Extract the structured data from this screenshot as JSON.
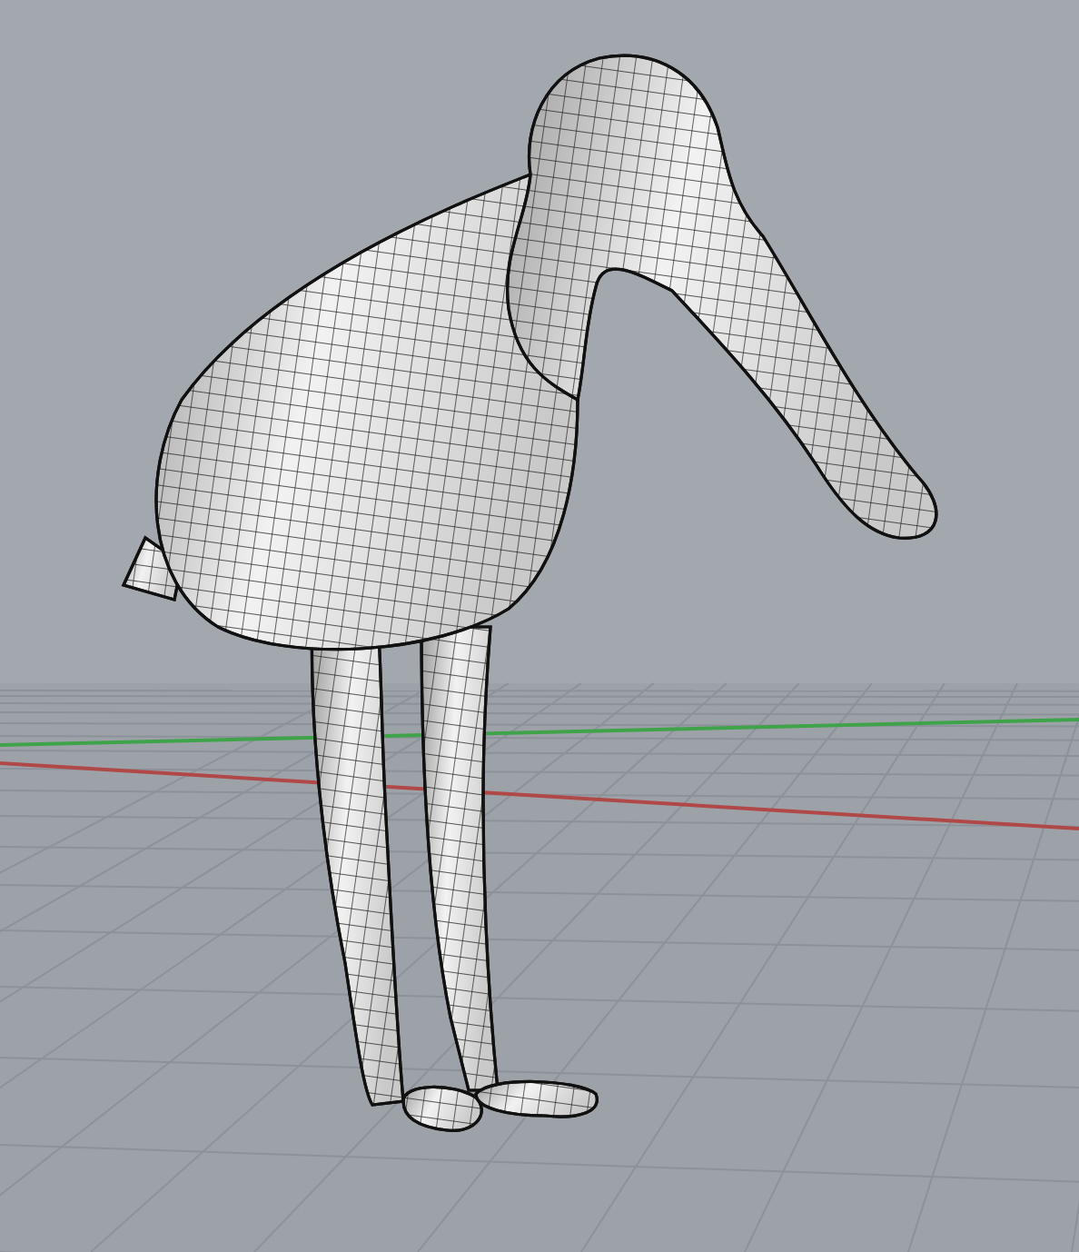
{
  "viewport": {
    "axes": [
      {
        "kind": "x",
        "color": "#b04848"
      },
      {
        "kind": "y",
        "color": "#3fa34a"
      }
    ]
  }
}
